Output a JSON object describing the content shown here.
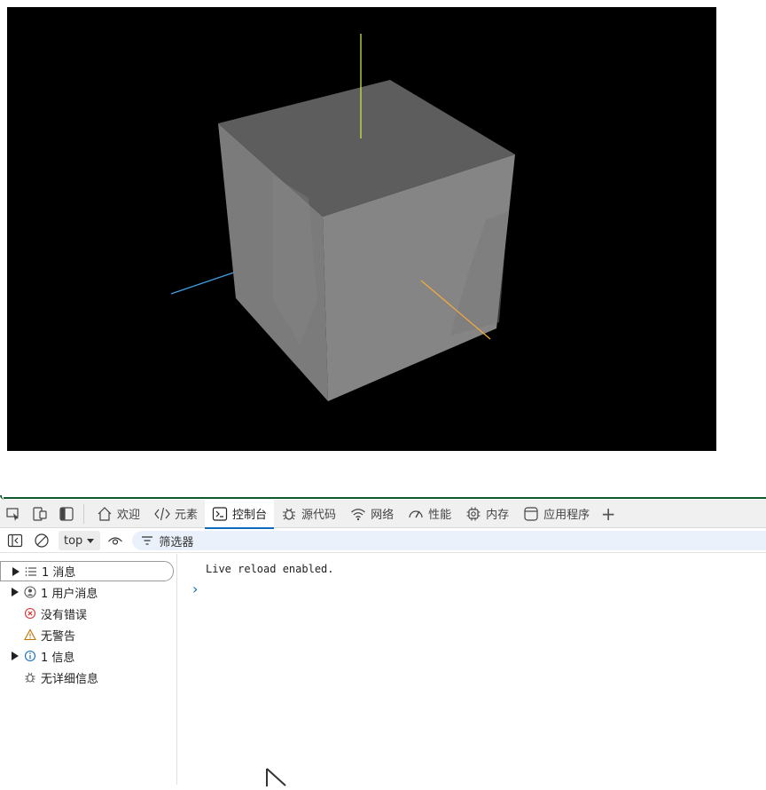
{
  "devtools": {
    "tabs": [
      {
        "id": "welcome",
        "label": "欢迎",
        "icon": "home-icon"
      },
      {
        "id": "elements",
        "label": "元素",
        "icon": "code-icon"
      },
      {
        "id": "console",
        "label": "控制台",
        "icon": "console-icon",
        "active": true
      },
      {
        "id": "sources",
        "label": "源代码",
        "icon": "bug-icon"
      },
      {
        "id": "network",
        "label": "网络",
        "icon": "wifi-icon"
      },
      {
        "id": "performance",
        "label": "性能",
        "icon": "gauge-icon"
      },
      {
        "id": "memory",
        "label": "内存",
        "icon": "chip-icon"
      },
      {
        "id": "application",
        "label": "应用程序",
        "icon": "app-window-icon"
      }
    ],
    "add_tab_label": "+",
    "console_toolbar": {
      "context": "top",
      "filter_placeholder": "筛选器"
    },
    "sidebar": [
      {
        "label": "1 消息",
        "icon": "list-icon",
        "expandable": true,
        "selected": true
      },
      {
        "label": "1 用户消息",
        "icon": "user-icon",
        "expandable": true
      },
      {
        "label": "没有错误",
        "icon": "error-icon",
        "expandable": false
      },
      {
        "label": "无警告",
        "icon": "warning-icon",
        "expandable": false
      },
      {
        "label": "1 信息",
        "icon": "info-icon",
        "expandable": true
      },
      {
        "label": "无详细信息",
        "icon": "bug-icon",
        "expandable": false
      }
    ],
    "log": [
      {
        "text": "Live reload enabled."
      }
    ],
    "prompt_symbol": "›"
  },
  "colors": {
    "accent": "#0f6cbd",
    "split_border": "#0f5a2d",
    "axis_x": "#f2a93b",
    "axis_y": "#c8e64a",
    "axis_z": "#3aa0e8"
  }
}
